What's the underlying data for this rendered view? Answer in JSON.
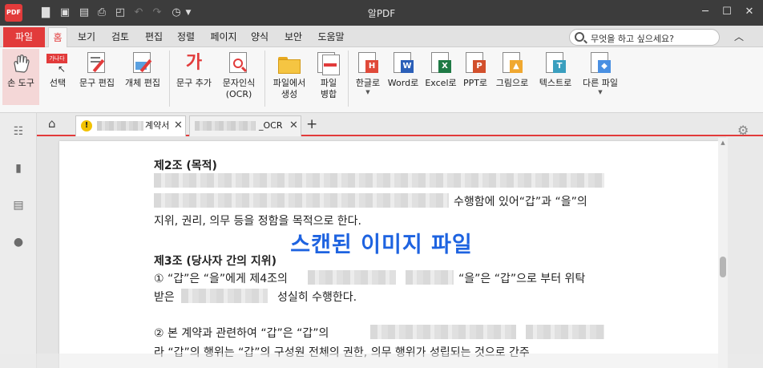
{
  "app": {
    "logo_text": "PDF",
    "title": "알PDF",
    "window_controls": [
      "minimize-icon",
      "maximize-icon",
      "close-icon"
    ],
    "quick_access": [
      "folder-icon",
      "save-icon",
      "save-all-icon",
      "print-icon",
      "print-preview-icon",
      "undo-icon",
      "redo-icon",
      "history-icon"
    ]
  },
  "menu": {
    "file": "파일",
    "tabs": [
      "홈",
      "보기",
      "검토",
      "편집",
      "정렬",
      "페이지",
      "양식",
      "보안",
      "도움말"
    ],
    "active_tab": "홈",
    "search_placeholder": "무엇을 하고 싶으세요?"
  },
  "ribbon": {
    "hand_tool": "손 도구",
    "select": "선택",
    "select_icon_text": "가나다",
    "edit_text": "문구 편집",
    "edit_object": "개체 편집",
    "add_text": "문구 추가",
    "add_text_icon": "가",
    "ocr_line1": "문자인식",
    "ocr_line2": "(OCR)",
    "create_from_file_line1": "파일에서",
    "create_from_file_line2": "생성",
    "merge_line1": "파일",
    "merge_line2": "병합",
    "to_hangul": "한글로",
    "to_word": "Word로",
    "to_excel": "Excel로",
    "to_ppt": "PPT로",
    "to_image": "그림으로",
    "to_text": "텍스트로",
    "other_file": "다른 파일"
  },
  "doc_tabs": {
    "tab1_suffix": "계약서",
    "tab2_suffix": "_OCR"
  },
  "document": {
    "art2_heading": "제2조 (목적)",
    "art2_line2_tail": "수행함에 있어“갑”과 “을”의",
    "art2_line3": "지위, 권리, 의무 등을 정함을 목적으로 한다.",
    "art3_heading": "제3조 (당사자 간의 지위)",
    "art3_p1_a": "① “갑”은 “을”에게 제4조의",
    "art3_p1_b": "“을”은 “갑”으로 부터 위탁",
    "art3_p1_c1": "받은",
    "art3_p1_c2": "성실히 수행한다.",
    "art3_p2_a": "② 본 계약과 관련하여 “갑”은 “갑”의",
    "art3_p2_b": "라 “갑”의 행위는 “갑”의 구성원 전체의 권한, 의무 행위가 성립되는 것으로 간주"
  },
  "overlay_text": "스캔된 이미지 파일",
  "colors": {
    "accent": "#e23b3b",
    "overlay": "#1e63e0",
    "titlebar": "#3c3c3c"
  }
}
